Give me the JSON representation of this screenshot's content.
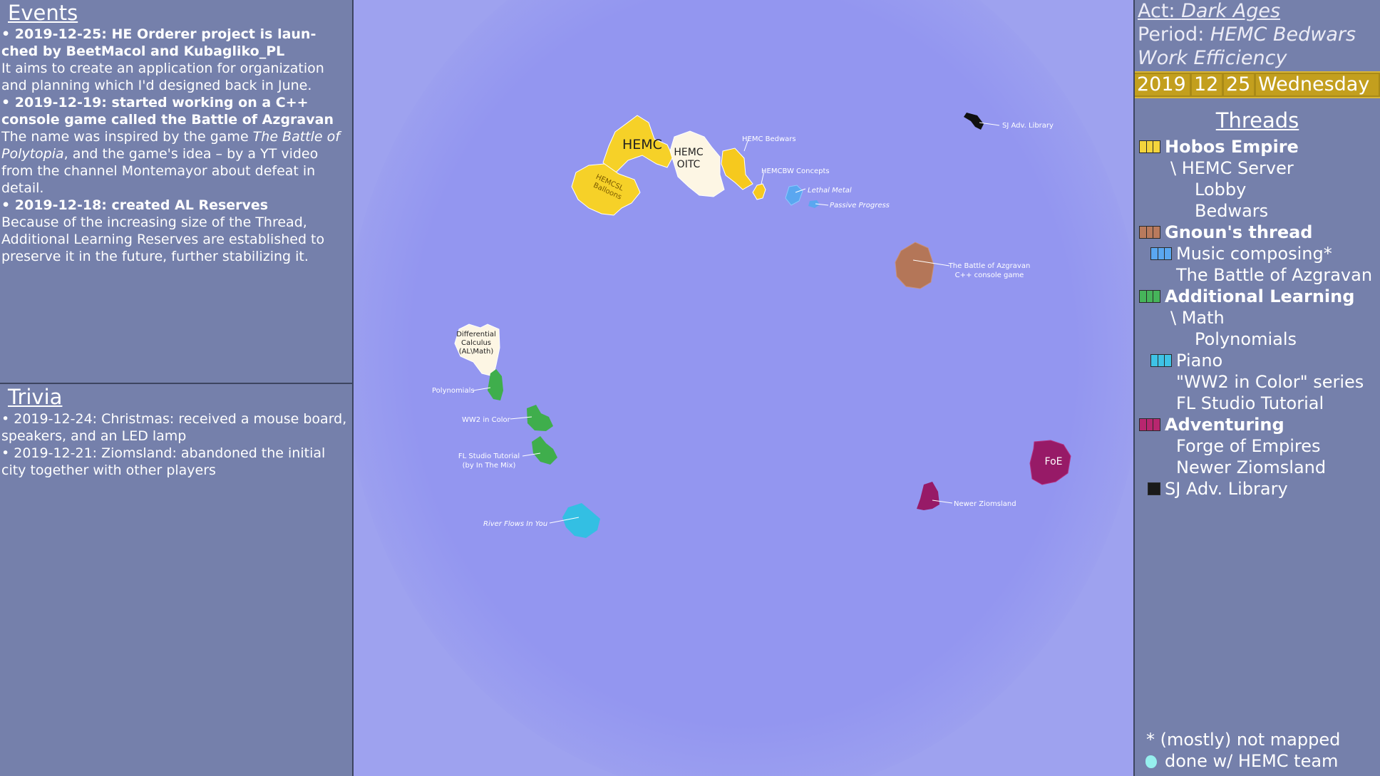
{
  "events": {
    "title": "Events",
    "entries": [
      {
        "head": "• 2019-12-25: HE Orderer project is laun-ched by BeetMacol and Kubagliko_PL",
        "body": "It aims to create an application for organization and planning which I'd designed back in June."
      },
      {
        "head": "• 2019-12-19: started working on a C++ console game called the Battle of Azgravan",
        "body_pre": "The name was inspired by the game ",
        "body_italic": "The Battle of Polytopia",
        "body_post": ", and the game's idea – by a YT video from the channel Montemayor about defeat in detail."
      },
      {
        "head": "• 2019-12-18: created AL Reserves",
        "body": "Because of the increasing size of the Thread, Additional Learning Reserves are established to preserve it in the future, further stabilizing it."
      }
    ]
  },
  "trivia": {
    "title": "Trivia",
    "entries": [
      "• 2019-12-24: Christmas: received a mouse board, speakers, and an LED lamp",
      "• 2019-12-21: Ziomsland: abandoned the initial city together with other players"
    ]
  },
  "header": {
    "act_label": "Act: ",
    "act_value": "Dark Ages",
    "period_label": "Period: ",
    "period_value": "HEMC Bedwars",
    "period_sub": "Work Efficiency",
    "date": {
      "year": "2019",
      "month": "12",
      "day": "25",
      "weekday": "Wednesday"
    }
  },
  "threads": {
    "title": "Threads",
    "items": [
      {
        "label": "Hobos Empire",
        "bold": true,
        "colors": [
          "#f4d43c",
          "#f4d43c",
          "#f4d43c"
        ]
      },
      {
        "label": "\\ HEMC Server"
      },
      {
        "label": "Lobby"
      },
      {
        "label": "Bedwars"
      },
      {
        "label": "Gnoun's thread",
        "bold": true,
        "colors": [
          "#b97a5d",
          "#b97a5d",
          "#b97a5d"
        ]
      },
      {
        "label": "Music composing*",
        "colors": [
          "#5aa7f0",
          "#5aa7f0",
          "#5aa7f0"
        ]
      },
      {
        "label": "The Battle of Azgravan"
      },
      {
        "label": "Additional Learning",
        "bold": true,
        "colors": [
          "#46b45a",
          "#46b45a",
          "#46b45a"
        ]
      },
      {
        "label": "\\ Math"
      },
      {
        "label": "Polynomials"
      },
      {
        "label": "Piano",
        "colors": [
          "#3ec3e6",
          "#3ec3e6",
          "#3ec3e6"
        ]
      },
      {
        "label": "\"WW2 in Color\" series"
      },
      {
        "label": "FL Studio Tutorial"
      },
      {
        "label": "Adventuring",
        "bold": true,
        "colors": [
          "#b8266f",
          "#b8266f",
          "#b8266f"
        ]
      },
      {
        "label": "Forge of Empires"
      },
      {
        "label": "Newer Ziomsland"
      },
      {
        "label": "SJ Adv. Library",
        "colors": [
          "#1a1a1a"
        ]
      }
    ],
    "footnote_mapped": "* (mostly) not mapped",
    "footnote_done": "done w/ HEMC team",
    "done_color": "#96efee"
  },
  "map": {
    "ocean_color": "#9396f0",
    "labels": {
      "hemc": "HEMC",
      "hemc_oitc_1": "HEMC",
      "hemc_oitc_2": "OITC",
      "hemcsl_1": "HEMCSL",
      "hemcsl_2": "Balloons",
      "hemc_bedwars": "HEMC Bedwars",
      "hemcbw_concepts": "HEMCBW Concepts",
      "lethal_metal": "Lethal Metal",
      "passive_progress": "Passive Progress",
      "sj_library": "SJ Adv. Library",
      "azgravan_1": "The Battle of Azgravan",
      "azgravan_2": "C++ console game",
      "diffcalc_1": "Differential",
      "diffcalc_2": "Calculus",
      "diffcalc_3": "(AL\\Math)",
      "polynomials": "Polynomials",
      "ww2": "WW2 in Color",
      "fl_1": "FL Studio Tutorial",
      "fl_2": "(by In The Mix)",
      "river": "River Flows In You",
      "foe": "FoE",
      "ziomsland": "Newer Ziomsland"
    }
  }
}
